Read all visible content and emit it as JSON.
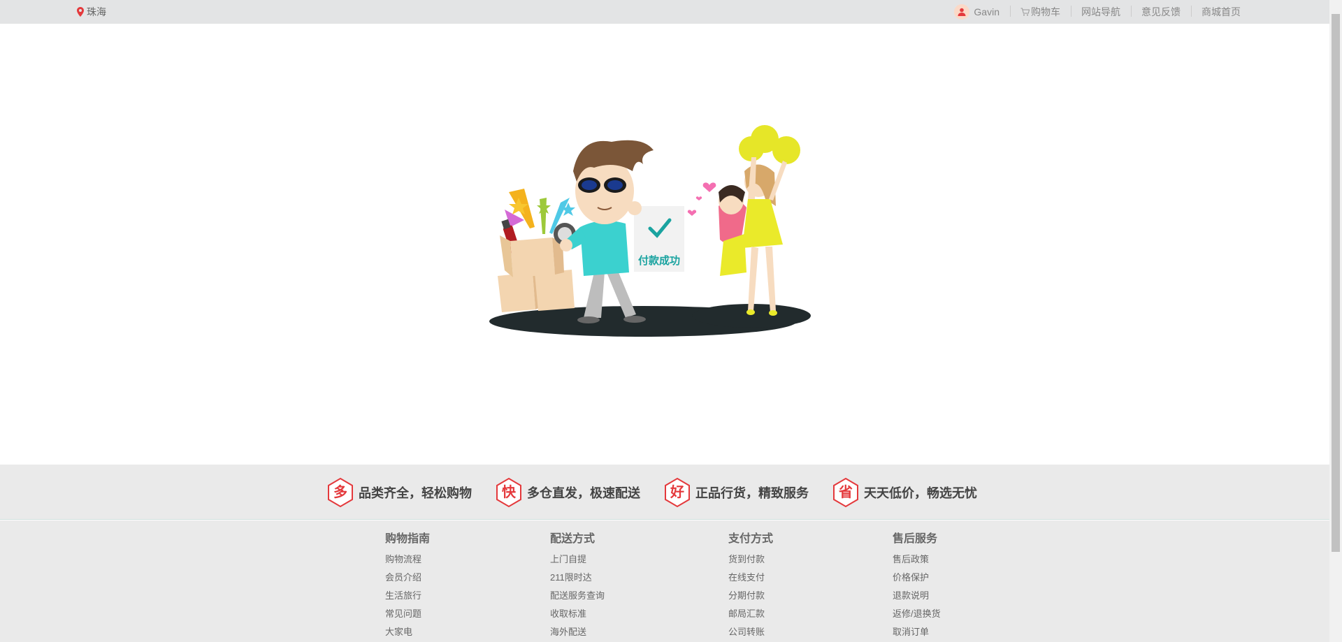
{
  "topbar": {
    "location": "珠海",
    "user": "Gavin",
    "cart": "购物车",
    "site_nav": "网站导航",
    "feedback": "意见反馈",
    "mall_home": "商城首页"
  },
  "illustration": {
    "badge_text": "付款成功"
  },
  "slogans": [
    {
      "icon": "多",
      "text": "品类齐全，轻松购物"
    },
    {
      "icon": "快",
      "text": "多仓直发，极速配送"
    },
    {
      "icon": "好",
      "text": "正品行货，精致服务"
    },
    {
      "icon": "省",
      "text": "天天低价，畅选无忧"
    }
  ],
  "footer": {
    "columns": [
      {
        "title": "购物指南",
        "links": [
          "购物流程",
          "会员介绍",
          "生活旅行",
          "常见问题",
          "大家电"
        ]
      },
      {
        "title": "配送方式",
        "links": [
          "上门自提",
          "211限时达",
          "配送服务查询",
          "收取标准",
          "海外配送"
        ]
      },
      {
        "title": "支付方式",
        "links": [
          "货到付款",
          "在线支付",
          "分期付款",
          "邮局汇款",
          "公司转账"
        ]
      },
      {
        "title": "售后服务",
        "links": [
          "售后政策",
          "价格保护",
          "退款说明",
          "返修/退换货",
          "取消订单"
        ]
      }
    ]
  },
  "colors": {
    "accent_red": "#e4393c",
    "topbar_bg": "#e3e4e5",
    "footer_bg": "#eaeaea"
  }
}
